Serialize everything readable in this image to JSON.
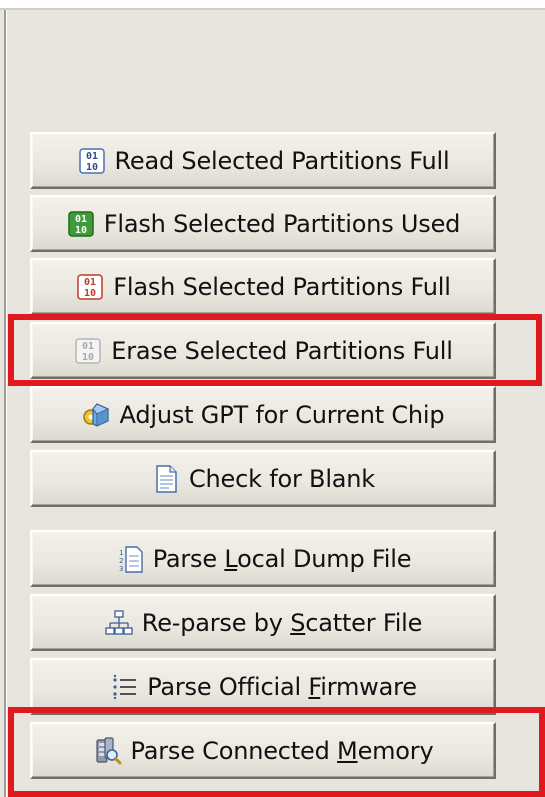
{
  "buttons": {
    "read_full": {
      "label": "Read Selected Partitions Full",
      "icon": "binary-chip-icon"
    },
    "flash_used": {
      "label": "Flash Selected Partitions Used",
      "icon": "binary-chip-green-icon"
    },
    "flash_full": {
      "label": "Flash Selected Partitions Full",
      "icon": "binary-chip-red-icon"
    },
    "erase_full": {
      "label": "Erase Selected Partitions Full",
      "icon": "binary-chip-faded-icon"
    },
    "adjust_gpt": {
      "label": "Adjust GPT for Current Chip",
      "icon": "cube-gear-icon"
    },
    "check_blank": {
      "label": "Check for Blank",
      "icon": "document-icon"
    },
    "parse_local": {
      "pre": "Parse ",
      "acc": "L",
      "post": "ocal Dump File",
      "icon": "numbered-document-icon"
    },
    "reparse_scatter": {
      "pre": "Re-parse by ",
      "acc": "S",
      "post": "catter File",
      "icon": "tree-network-icon"
    },
    "parse_official": {
      "pre": "Parse Official ",
      "acc": "F",
      "post": "irmware",
      "icon": "list-icon"
    },
    "parse_memory": {
      "pre": "Parse Connected ",
      "acc": "M",
      "post": "emory",
      "icon": "memory-search-icon"
    }
  },
  "highlight_color": "#e0191f"
}
